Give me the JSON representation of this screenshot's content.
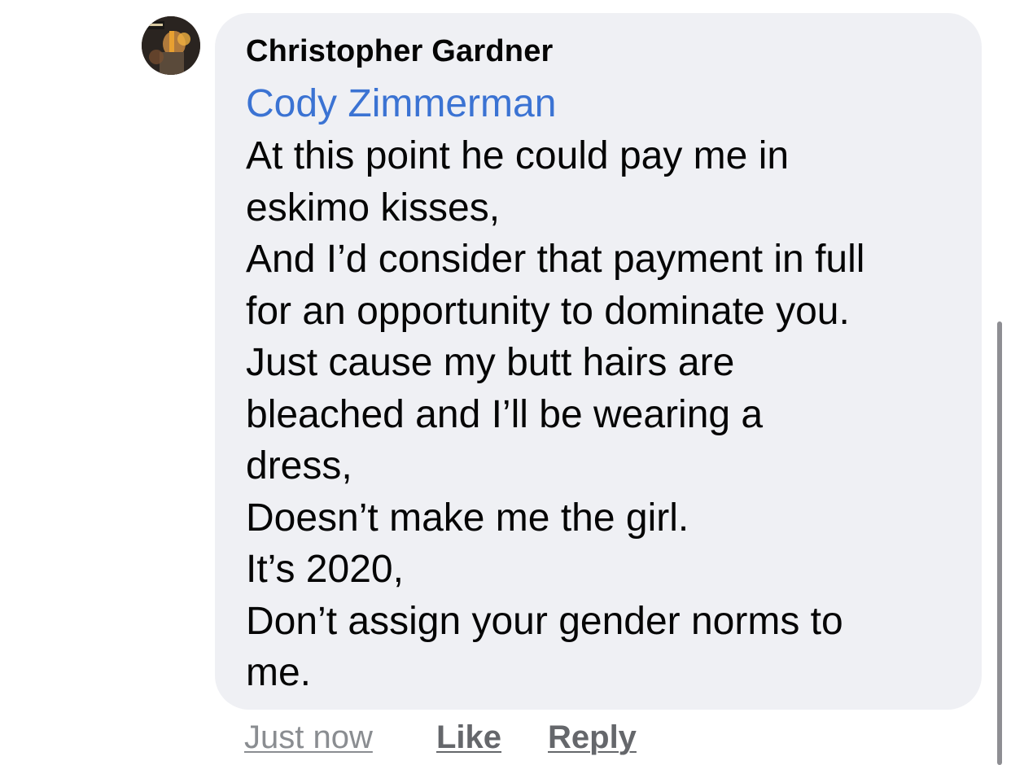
{
  "comment": {
    "author": "Christopher Gardner",
    "mention": "Cody Zimmerman",
    "lines": [
      "At this point he could pay me in",
      "eskimo kisses,",
      "And I’d consider that payment in full",
      "for an opportunity to dominate you.",
      "Just cause my butt hairs are",
      "bleached and I’ll be wearing a",
      "dress,",
      "Doesn’t make me the girl.",
      "It’s 2020,",
      "Don’t assign your gender norms to",
      "me."
    ]
  },
  "actions": {
    "timestamp": "Just now",
    "like_label": "Like",
    "reply_label": "Reply"
  },
  "colors": {
    "bubble": "#eff0f4",
    "mention": "#3b73d3",
    "action": "#65676b",
    "timestamp": "#8a8d91"
  },
  "icons": {
    "avatar": "profile-photo"
  }
}
